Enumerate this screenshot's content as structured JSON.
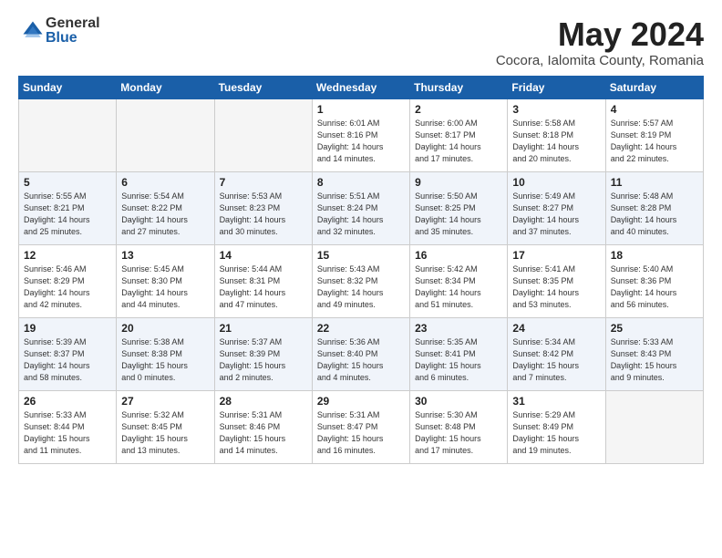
{
  "header": {
    "logo_general": "General",
    "logo_blue": "Blue",
    "month_year": "May 2024",
    "location": "Cocora, Ialomita County, Romania"
  },
  "days_of_week": [
    "Sunday",
    "Monday",
    "Tuesday",
    "Wednesday",
    "Thursday",
    "Friday",
    "Saturday"
  ],
  "weeks": [
    [
      {
        "num": "",
        "info": ""
      },
      {
        "num": "",
        "info": ""
      },
      {
        "num": "",
        "info": ""
      },
      {
        "num": "1",
        "info": "Sunrise: 6:01 AM\nSunset: 8:16 PM\nDaylight: 14 hours\nand 14 minutes."
      },
      {
        "num": "2",
        "info": "Sunrise: 6:00 AM\nSunset: 8:17 PM\nDaylight: 14 hours\nand 17 minutes."
      },
      {
        "num": "3",
        "info": "Sunrise: 5:58 AM\nSunset: 8:18 PM\nDaylight: 14 hours\nand 20 minutes."
      },
      {
        "num": "4",
        "info": "Sunrise: 5:57 AM\nSunset: 8:19 PM\nDaylight: 14 hours\nand 22 minutes."
      }
    ],
    [
      {
        "num": "5",
        "info": "Sunrise: 5:55 AM\nSunset: 8:21 PM\nDaylight: 14 hours\nand 25 minutes."
      },
      {
        "num": "6",
        "info": "Sunrise: 5:54 AM\nSunset: 8:22 PM\nDaylight: 14 hours\nand 27 minutes."
      },
      {
        "num": "7",
        "info": "Sunrise: 5:53 AM\nSunset: 8:23 PM\nDaylight: 14 hours\nand 30 minutes."
      },
      {
        "num": "8",
        "info": "Sunrise: 5:51 AM\nSunset: 8:24 PM\nDaylight: 14 hours\nand 32 minutes."
      },
      {
        "num": "9",
        "info": "Sunrise: 5:50 AM\nSunset: 8:25 PM\nDaylight: 14 hours\nand 35 minutes."
      },
      {
        "num": "10",
        "info": "Sunrise: 5:49 AM\nSunset: 8:27 PM\nDaylight: 14 hours\nand 37 minutes."
      },
      {
        "num": "11",
        "info": "Sunrise: 5:48 AM\nSunset: 8:28 PM\nDaylight: 14 hours\nand 40 minutes."
      }
    ],
    [
      {
        "num": "12",
        "info": "Sunrise: 5:46 AM\nSunset: 8:29 PM\nDaylight: 14 hours\nand 42 minutes."
      },
      {
        "num": "13",
        "info": "Sunrise: 5:45 AM\nSunset: 8:30 PM\nDaylight: 14 hours\nand 44 minutes."
      },
      {
        "num": "14",
        "info": "Sunrise: 5:44 AM\nSunset: 8:31 PM\nDaylight: 14 hours\nand 47 minutes."
      },
      {
        "num": "15",
        "info": "Sunrise: 5:43 AM\nSunset: 8:32 PM\nDaylight: 14 hours\nand 49 minutes."
      },
      {
        "num": "16",
        "info": "Sunrise: 5:42 AM\nSunset: 8:34 PM\nDaylight: 14 hours\nand 51 minutes."
      },
      {
        "num": "17",
        "info": "Sunrise: 5:41 AM\nSunset: 8:35 PM\nDaylight: 14 hours\nand 53 minutes."
      },
      {
        "num": "18",
        "info": "Sunrise: 5:40 AM\nSunset: 8:36 PM\nDaylight: 14 hours\nand 56 minutes."
      }
    ],
    [
      {
        "num": "19",
        "info": "Sunrise: 5:39 AM\nSunset: 8:37 PM\nDaylight: 14 hours\nand 58 minutes."
      },
      {
        "num": "20",
        "info": "Sunrise: 5:38 AM\nSunset: 8:38 PM\nDaylight: 15 hours\nand 0 minutes."
      },
      {
        "num": "21",
        "info": "Sunrise: 5:37 AM\nSunset: 8:39 PM\nDaylight: 15 hours\nand 2 minutes."
      },
      {
        "num": "22",
        "info": "Sunrise: 5:36 AM\nSunset: 8:40 PM\nDaylight: 15 hours\nand 4 minutes."
      },
      {
        "num": "23",
        "info": "Sunrise: 5:35 AM\nSunset: 8:41 PM\nDaylight: 15 hours\nand 6 minutes."
      },
      {
        "num": "24",
        "info": "Sunrise: 5:34 AM\nSunset: 8:42 PM\nDaylight: 15 hours\nand 7 minutes."
      },
      {
        "num": "25",
        "info": "Sunrise: 5:33 AM\nSunset: 8:43 PM\nDaylight: 15 hours\nand 9 minutes."
      }
    ],
    [
      {
        "num": "26",
        "info": "Sunrise: 5:33 AM\nSunset: 8:44 PM\nDaylight: 15 hours\nand 11 minutes."
      },
      {
        "num": "27",
        "info": "Sunrise: 5:32 AM\nSunset: 8:45 PM\nDaylight: 15 hours\nand 13 minutes."
      },
      {
        "num": "28",
        "info": "Sunrise: 5:31 AM\nSunset: 8:46 PM\nDaylight: 15 hours\nand 14 minutes."
      },
      {
        "num": "29",
        "info": "Sunrise: 5:31 AM\nSunset: 8:47 PM\nDaylight: 15 hours\nand 16 minutes."
      },
      {
        "num": "30",
        "info": "Sunrise: 5:30 AM\nSunset: 8:48 PM\nDaylight: 15 hours\nand 17 minutes."
      },
      {
        "num": "31",
        "info": "Sunrise: 5:29 AM\nSunset: 8:49 PM\nDaylight: 15 hours\nand 19 minutes."
      },
      {
        "num": "",
        "info": ""
      }
    ]
  ]
}
